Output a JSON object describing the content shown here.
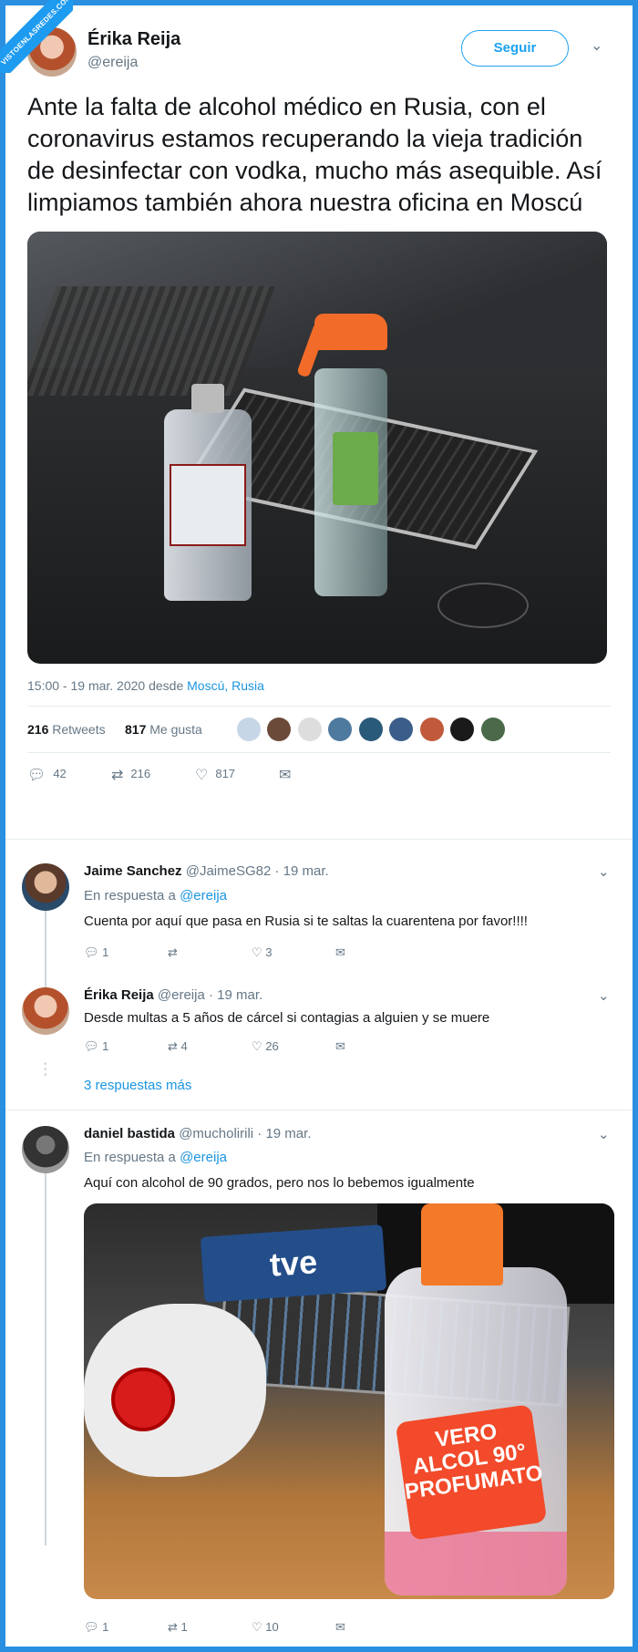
{
  "watermark": "VISTOENLASREDES.COM",
  "tweet": {
    "name": "Érika Reija",
    "handle": "@ereija",
    "follow_label": "Seguir",
    "text": "Ante la falta de alcohol médico en Rusia, con el coronavirus estamos recuperando la vieja tradición de desinfectar con vodka, mucho más asequible. Así limpiamos también ahora nuestra oficina en Moscú",
    "time": "15:00 - 19 mar. 2020 desde ",
    "location": "Moscú, Rusia",
    "retweets_count": "216",
    "retweets_label": "Retweets",
    "likes_count": "817",
    "likes_label": "Me gusta",
    "actions": {
      "replies": "42",
      "retweets": "216",
      "likes": "817"
    }
  },
  "replies": [
    {
      "name": "Jaime Sanchez",
      "handle": "@JaimeSG82",
      "date": "· 19 mar.",
      "reply_prefix": "En respuesta a ",
      "reply_to": "@ereija",
      "text": "Cuenta por aquí que pasa en Rusia si te saltas la cuarentena por favor!!!!",
      "replies": "1",
      "retweets": "",
      "likes": "3"
    },
    {
      "name": "Érika Reija",
      "handle": "@ereija",
      "date": "· 19 mar.",
      "text": "Desde multas a 5 años de cárcel si contagias a alguien y se muere",
      "replies": "1",
      "retweets": "4",
      "likes": "26"
    },
    {
      "name": "daniel bastida",
      "handle": "@mucholirili",
      "date": "· 19 mar.",
      "reply_prefix": "En respuesta a ",
      "reply_to": "@ereija",
      "text": "Aquí con alcohol de 90 grados, pero nos lo bebemos igualmente",
      "replies": "1",
      "retweets": "1",
      "likes": "10"
    }
  ],
  "more_replies": "3 respuestas más",
  "photo2_text": {
    "tve": "tve",
    "label": "VERO ALCOL 90° PROFUMATO"
  },
  "colors": {
    "accent": "#1da1f2",
    "frame": "#2a8fe0",
    "muted": "#657786"
  }
}
